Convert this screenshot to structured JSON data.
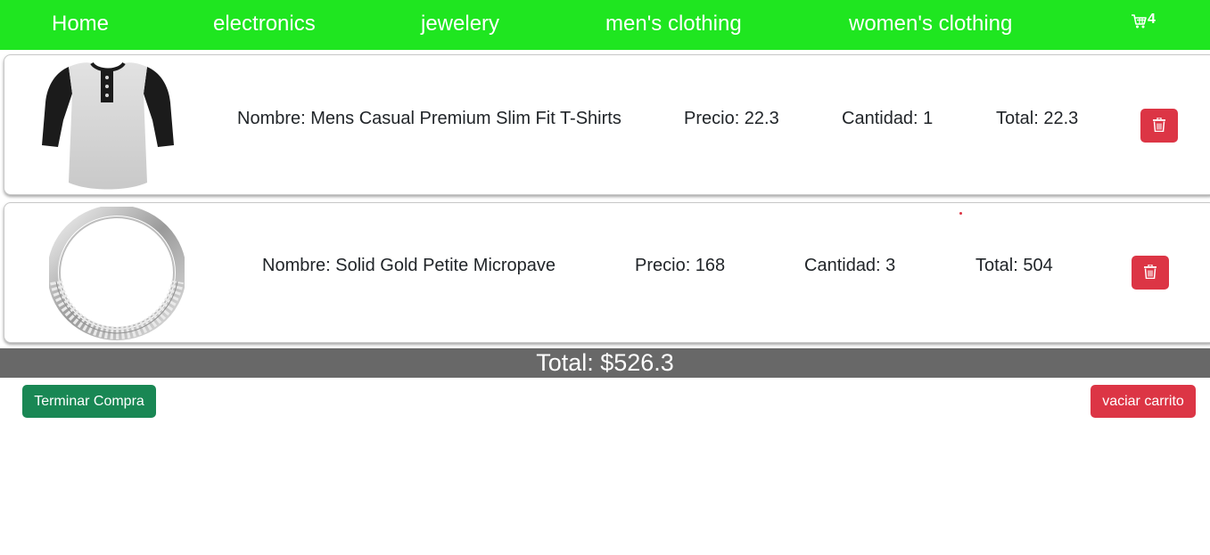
{
  "nav": {
    "links": [
      "Home",
      "electronics",
      "jewelery",
      "men's clothing",
      "women's clothing"
    ],
    "cart_count": "4",
    "cart_icon": "cart-icon"
  },
  "cart_items": [
    {
      "image_icon": "tshirt-image",
      "name": "Nombre: Mens Casual Premium Slim Fit T-Shirts",
      "price": "Precio: 22.3",
      "quantity": "Cantidad: 1",
      "total": "Total: 22.3",
      "delete_icon": "trash-icon"
    },
    {
      "image_icon": "ring-image",
      "name": "Nombre: Solid Gold Petite Micropave",
      "price": "Precio: 168",
      "quantity": "Cantidad: 3",
      "total": "Total: 504",
      "delete_icon": "trash-icon"
    }
  ],
  "summary": {
    "total": "Total: $526.3"
  },
  "actions": {
    "finish_label": "Terminar Compra",
    "empty_label": "vaciar carrito"
  },
  "colors": {
    "navbar": "#1fe620",
    "danger": "#dc3545",
    "success": "#198754",
    "total_bar": "#686868"
  }
}
